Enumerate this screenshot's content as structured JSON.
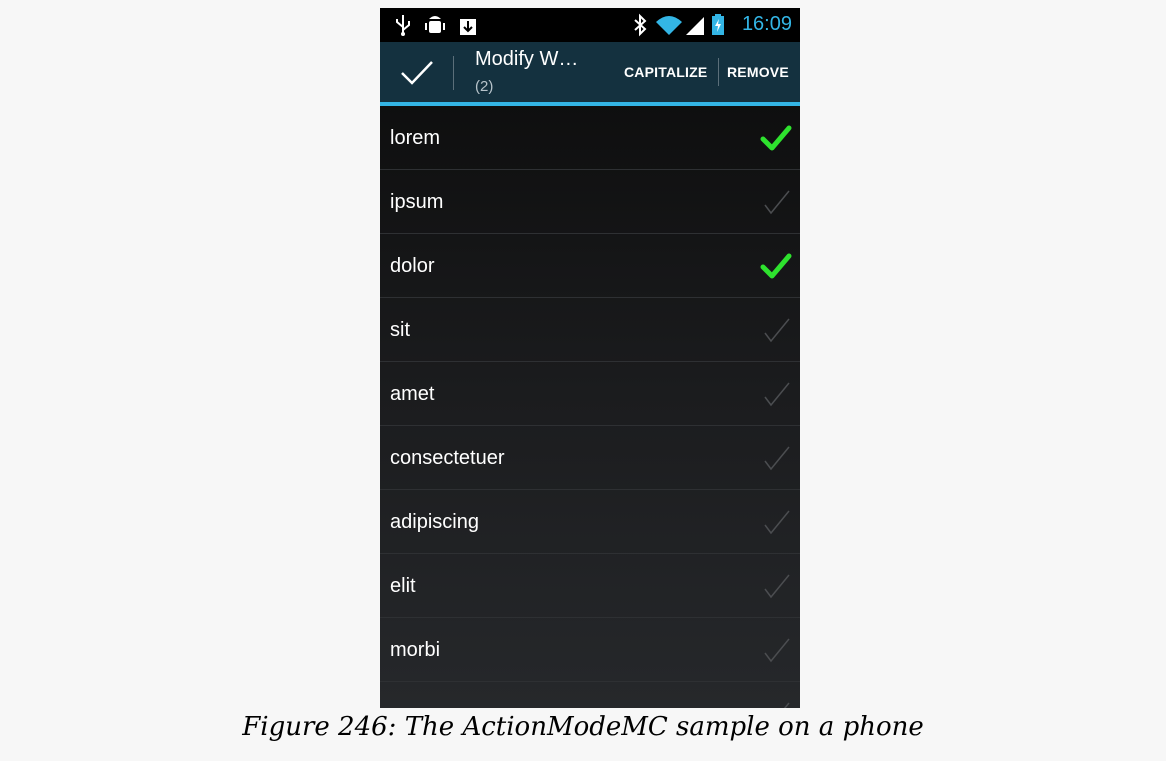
{
  "status_bar": {
    "time": "16:09",
    "icons": [
      "usb-icon",
      "android-debug-icon",
      "download-icon",
      "bluetooth-icon",
      "wifi-icon",
      "signal-icon",
      "battery-charging-icon"
    ]
  },
  "action_mode": {
    "title": "Modify W…",
    "subtitle": "(2)",
    "done_icon": "checkmark-icon",
    "actions": {
      "capitalize": "CAPITALIZE",
      "remove": "REMOVE"
    }
  },
  "list": {
    "items": [
      {
        "label": "lorem",
        "checked": true
      },
      {
        "label": "ipsum",
        "checked": false
      },
      {
        "label": "dolor",
        "checked": true
      },
      {
        "label": "sit",
        "checked": false
      },
      {
        "label": "amet",
        "checked": false
      },
      {
        "label": "consectetuer",
        "checked": false
      },
      {
        "label": "adipiscing",
        "checked": false
      },
      {
        "label": "elit",
        "checked": false
      },
      {
        "label": "morbi",
        "checked": false
      }
    ]
  },
  "colors": {
    "accent": "#33b5e5",
    "checked": "#2ee22e",
    "action_bar": "#14313f"
  },
  "caption": "Figure 246: The ActionModeMC sample on a phone"
}
